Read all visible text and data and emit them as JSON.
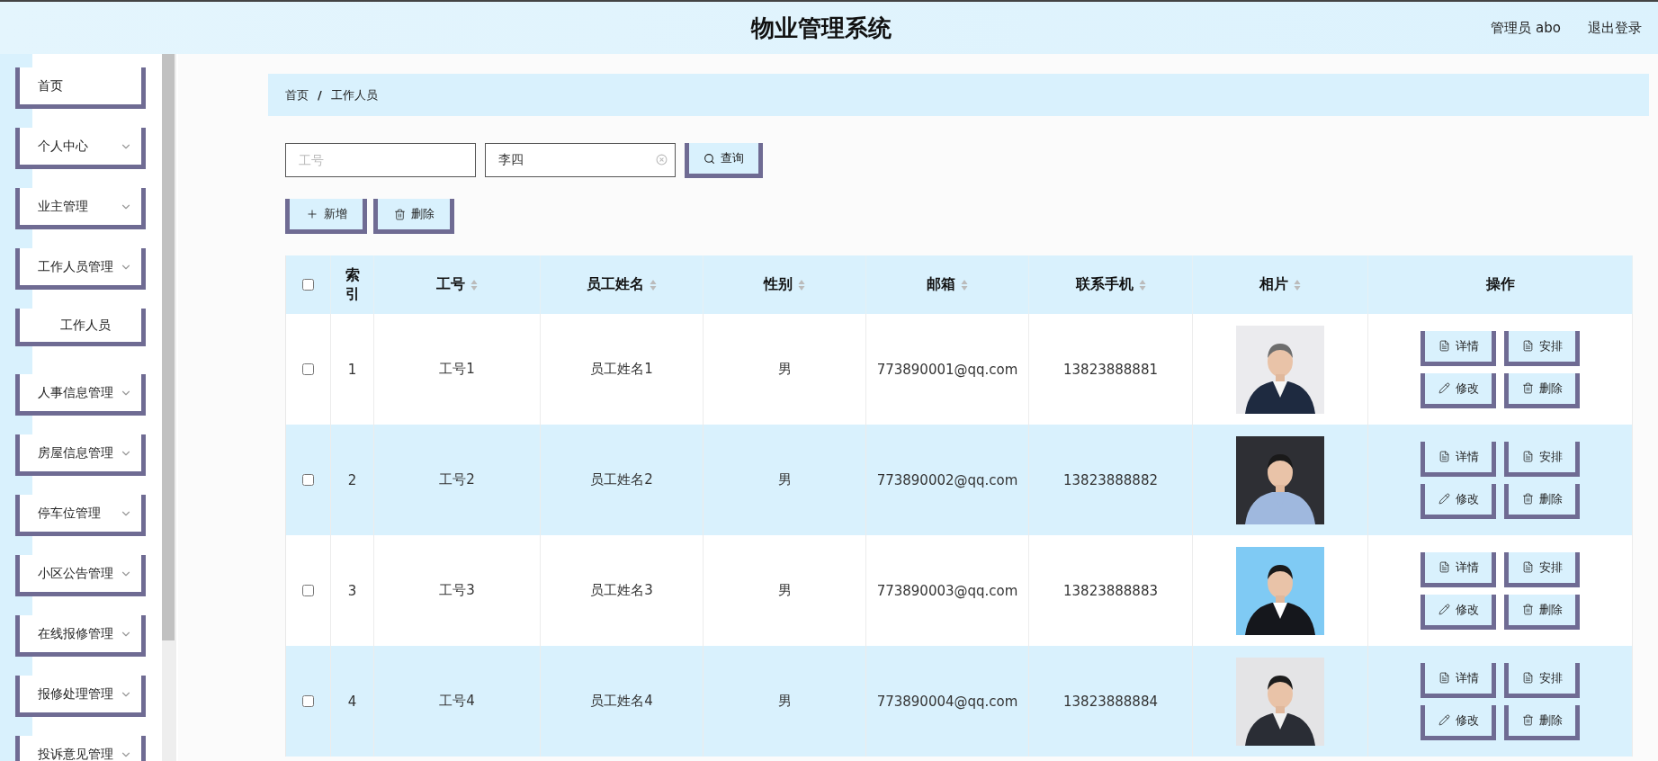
{
  "header": {
    "title": "物业管理系统",
    "user": "管理员 abo",
    "logout": "退出登录"
  },
  "sidebar": {
    "items": [
      {
        "label": "首页",
        "expandable": false
      },
      {
        "label": "个人中心",
        "expandable": true,
        "expanded": false
      },
      {
        "label": "业主管理",
        "expandable": true,
        "expanded": false
      },
      {
        "label": "工作人员管理",
        "expandable": true,
        "expanded": true,
        "children": [
          {
            "label": "工作人员",
            "selected": true
          }
        ]
      },
      {
        "label": "人事信息管理",
        "expandable": true,
        "expanded": false
      },
      {
        "label": "房屋信息管理",
        "expandable": true,
        "expanded": false
      },
      {
        "label": "停车位管理",
        "expandable": true,
        "expanded": false
      },
      {
        "label": "小区公告管理",
        "expandable": true,
        "expanded": false
      },
      {
        "label": "在线报修管理",
        "expandable": true,
        "expanded": false
      },
      {
        "label": "报修处理管理",
        "expandable": true,
        "expanded": false
      },
      {
        "label": "投诉意见管理",
        "expandable": true,
        "expanded": false
      }
    ]
  },
  "breadcrumb": [
    "首页",
    "工作人员"
  ],
  "breadcrumb_separator": "/",
  "search": {
    "fields": [
      {
        "placeholder": "工号"
      },
      {
        "value": "李四",
        "clearable": true
      }
    ],
    "button": "查询"
  },
  "toolbar": [
    {
      "label": "新增",
      "kind": "add"
    },
    {
      "label": "删除",
      "kind": "delete"
    }
  ],
  "table": {
    "header_checkbox": {
      "checked": false
    },
    "columns": [
      {
        "label": "索引",
        "sortable": false
      },
      {
        "label": "工号",
        "sortable": true
      },
      {
        "label": "员工姓名",
        "sortable": true
      },
      {
        "label": "性别",
        "sortable": true
      },
      {
        "label": "邮箱",
        "sortable": true
      },
      {
        "label": "联系手机",
        "sortable": true
      },
      {
        "label": "相片",
        "sortable": true
      },
      {
        "label": "操作",
        "sortable": false
      }
    ],
    "rows": [
      {
        "checked": false,
        "index": "1",
        "id": "工号1",
        "name": "员工姓名1",
        "gender": "男",
        "email": "773890001@qq.com",
        "phone": "13823888881",
        "actions": [
          {
            "label": "详情",
            "kind": "detail"
          },
          {
            "label": "安排",
            "kind": "detail"
          },
          {
            "label": "修改",
            "kind": "edit"
          },
          {
            "label": "删除",
            "kind": "delete"
          }
        ]
      },
      {
        "checked": false,
        "index": "2",
        "id": "工号2",
        "name": "员工姓名2",
        "gender": "男",
        "email": "773890002@qq.com",
        "phone": "13823888882",
        "actions": [
          {
            "label": "详情",
            "kind": "detail"
          },
          {
            "label": "安排",
            "kind": "detail"
          },
          {
            "label": "修改",
            "kind": "edit"
          },
          {
            "label": "删除",
            "kind": "delete"
          }
        ]
      },
      {
        "checked": false,
        "index": "3",
        "id": "工号3",
        "name": "员工姓名3",
        "gender": "男",
        "email": "773890003@qq.com",
        "phone": "13823888883",
        "actions": [
          {
            "label": "详情",
            "kind": "detail"
          },
          {
            "label": "安排",
            "kind": "detail"
          },
          {
            "label": "修改",
            "kind": "edit"
          },
          {
            "label": "删除",
            "kind": "delete"
          }
        ]
      },
      {
        "checked": false,
        "index": "4",
        "id": "工号4",
        "name": "员工姓名4",
        "gender": "男",
        "email": "773890004@qq.com",
        "phone": "13823888884",
        "actions": [
          {
            "label": "详情",
            "kind": "detail"
          },
          {
            "label": "安排",
            "kind": "detail"
          },
          {
            "label": "修改",
            "kind": "edit"
          },
          {
            "label": "删除",
            "kind": "delete"
          }
        ]
      }
    ]
  }
}
